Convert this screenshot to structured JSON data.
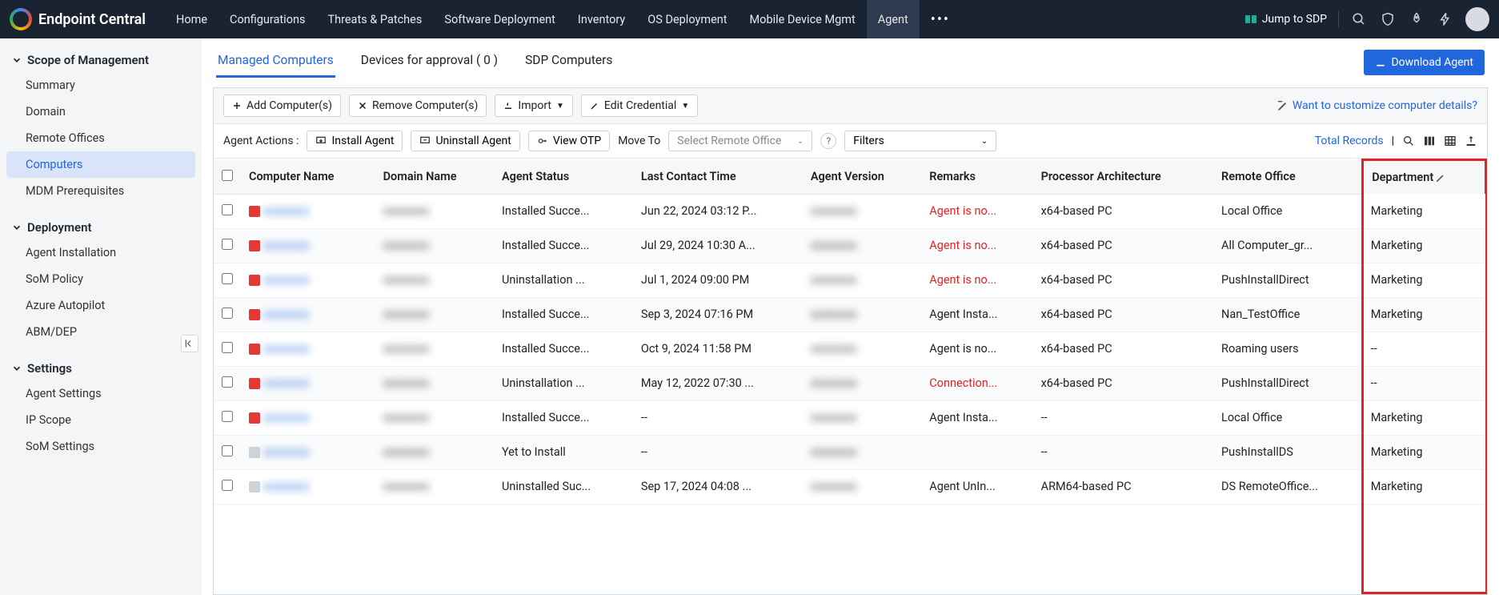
{
  "app": {
    "name": "Endpoint Central"
  },
  "nav": {
    "items": [
      "Home",
      "Configurations",
      "Threats & Patches",
      "Software Deployment",
      "Inventory",
      "OS Deployment",
      "Mobile Device Mgmt",
      "Agent"
    ],
    "active": "Agent",
    "jump": "Jump to SDP"
  },
  "sidebar": {
    "sections": [
      {
        "title": "Scope of Management",
        "items": [
          "Summary",
          "Domain",
          "Remote Offices",
          "Computers",
          "MDM Prerequisites"
        ],
        "active": "Computers"
      },
      {
        "title": "Deployment",
        "items": [
          "Agent Installation",
          "SoM Policy",
          "Azure Autopilot",
          "ABM/DEP"
        ]
      },
      {
        "title": "Settings",
        "items": [
          "Agent Settings",
          "IP Scope",
          "SoM Settings"
        ]
      }
    ]
  },
  "subtabs": {
    "items": [
      "Managed Computers",
      "Devices for approval ( 0 )",
      "SDP Computers"
    ],
    "active": "Managed Computers",
    "download": "Download Agent"
  },
  "toolbar": {
    "add": "Add Computer(s)",
    "remove": "Remove Computer(s)",
    "import": "Import",
    "edit_cred": "Edit Credential",
    "customize": "Want to customize computer details?"
  },
  "actionbar": {
    "label": "Agent Actions :",
    "install": "Install Agent",
    "uninstall": "Uninstall Agent",
    "viewotp": "View OTP",
    "moveto": "Move To",
    "select_ro": "Select Remote Office",
    "filters": "Filters",
    "total": "Total Records"
  },
  "table": {
    "headers": [
      "",
      "Computer Name",
      "Domain Name",
      "Agent Status",
      "Last Contact Time",
      "Agent Version",
      "Remarks",
      "Processor Architecture",
      "Remote Office",
      "Department"
    ],
    "rows": [
      {
        "status": "Installed Succe...",
        "contact": "Jun 22, 2024 03:12 P...",
        "remark": "Agent is no...",
        "remark_red": true,
        "arch": "x64-based PC",
        "office": "Local Office",
        "dept": "Marketing",
        "sq": "red"
      },
      {
        "status": "Installed Succe...",
        "contact": "Jul 29, 2024 10:30 A...",
        "remark": "Agent is no...",
        "remark_red": true,
        "arch": "x64-based PC",
        "office": "All Computer_gr...",
        "dept": "Marketing",
        "sq": "red"
      },
      {
        "status": "Uninstallation ...",
        "contact": "Jul 1, 2024 09:00 PM",
        "remark": "Agent is no...",
        "remark_red": true,
        "arch": "x64-based PC",
        "office": "PushInstallDirect",
        "dept": "Marketing",
        "sq": "red"
      },
      {
        "status": "Installed Succe...",
        "contact": "Sep 3, 2024 07:16 PM",
        "remark": "Agent Insta...",
        "remark_red": false,
        "arch": "x64-based PC",
        "office": "Nan_TestOffice",
        "dept": "Marketing",
        "sq": "red"
      },
      {
        "status": "Installed Succe...",
        "contact": "Oct 9, 2024 11:58 PM",
        "remark": "Agent is no...",
        "remark_red": false,
        "arch": "x64-based PC",
        "office": "Roaming users",
        "dept": "--",
        "sq": "red"
      },
      {
        "status": "Uninstallation ...",
        "contact": "May 12, 2022 07:30 ...",
        "remark": "Connection...",
        "remark_red": true,
        "arch": "x64-based PC",
        "office": "PushInstallDirect",
        "dept": "--",
        "sq": "red"
      },
      {
        "status": "Installed Succe...",
        "contact": "--",
        "remark": "Agent Insta...",
        "remark_red": false,
        "arch": "--",
        "office": "Local Office",
        "dept": "Marketing",
        "sq": "red"
      },
      {
        "status": "Yet to Install",
        "contact": "--",
        "remark": "",
        "remark_red": false,
        "arch": "--",
        "office": "PushInstallDS",
        "dept": "Marketing",
        "sq": "gray"
      },
      {
        "status": "Uninstalled Suc...",
        "contact": "Sep 17, 2024 04:08 ...",
        "remark": "Agent UnIn...",
        "remark_red": false,
        "arch": "ARM64-based PC",
        "office": "DS RemoteOffice...",
        "dept": "Marketing",
        "sq": "gray"
      }
    ]
  }
}
